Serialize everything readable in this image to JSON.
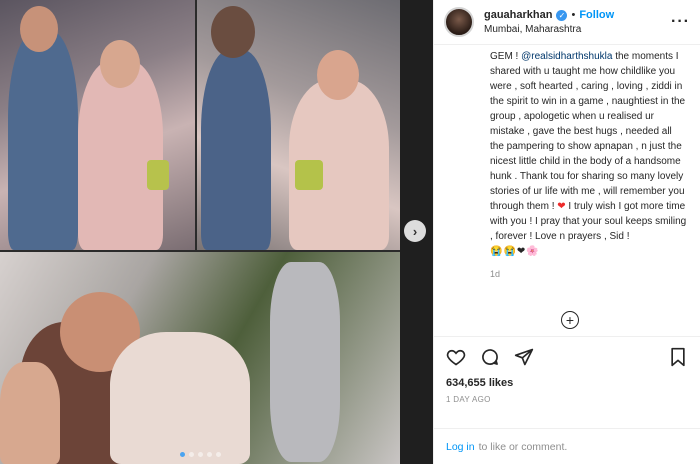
{
  "header": {
    "username": "gauaharkhan",
    "follow_label": "Follow",
    "separator": "•",
    "location": "Mumbai, Maharashtra",
    "more_label": "···"
  },
  "caption": {
    "lines": [
      "GEM ! ",
      "@realsidharthshukla",
      " the moments I shared with u taught me how childlike you were , soft hearted , caring , loving , ziddi in the spirit to win in a game , naughtiest in the group , apologetic when u realised ur mistake , gave the best hugs , needed all the pampering to show apnapan , n just the nicest little child in the body of a handsome hunk . Thank tou for sharing so many lovely stories of ur life with me , will remember you through them ! ",
      "❤",
      " I truly wish I got more time with you ! I pray that your soul keeps smiling , forever ! Love n prayers , Sid !",
      "😭😭❤🌸"
    ],
    "age": "1d"
  },
  "actions": {
    "likes": "634,655 likes",
    "date": "1 DAY AGO"
  },
  "login": {
    "link": "Log in",
    "text": "to like or comment."
  },
  "media": {
    "next_label": "›"
  }
}
